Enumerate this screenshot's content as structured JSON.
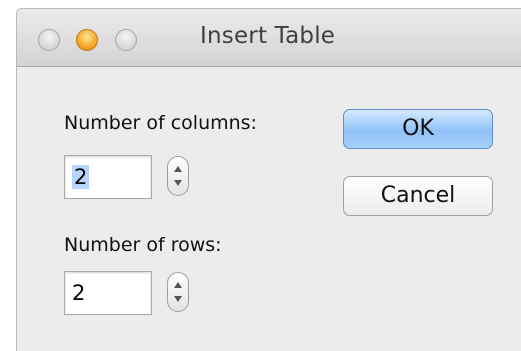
{
  "window": {
    "title": "Insert Table"
  },
  "form": {
    "columns_label": "Number of columns:",
    "columns_value": "2",
    "rows_label": "Number of rows:",
    "rows_value": "2"
  },
  "buttons": {
    "ok_label": "OK",
    "cancel_label": "Cancel"
  },
  "icons": {
    "close": "close-icon",
    "minimize": "minimize-icon",
    "zoom": "zoom-icon",
    "stepper_up": "chevron-up-icon",
    "stepper_down": "chevron-down-icon"
  },
  "colors": {
    "default_button": "#8fc1f7",
    "minimize_button": "#f4a623",
    "selection": "#b5d5ff"
  }
}
